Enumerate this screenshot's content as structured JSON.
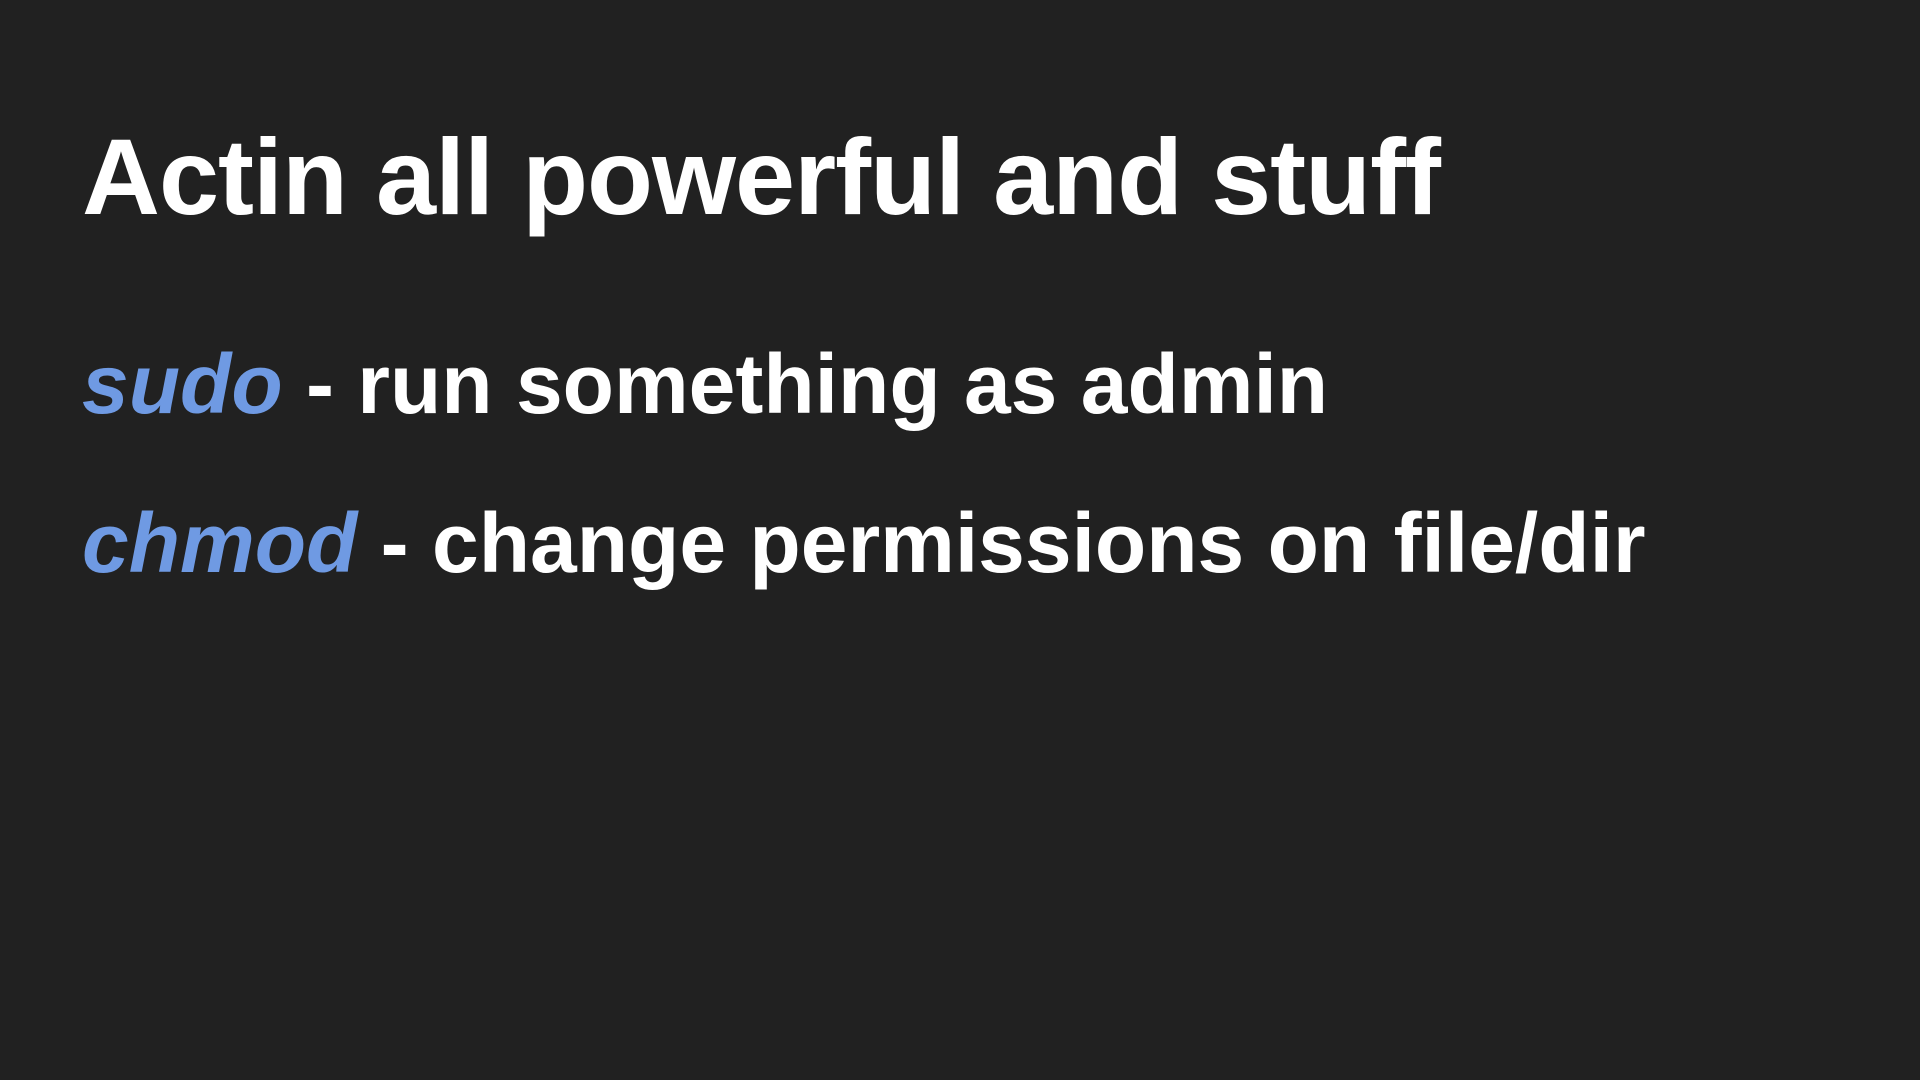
{
  "slide": {
    "title": "Actin all powerful and stuff",
    "items": [
      {
        "command": "sudo",
        "description": " - run something as admin"
      },
      {
        "command": "chmod",
        "description": " - change permissions on file/dir"
      }
    ]
  },
  "colors": {
    "background": "#212121",
    "text": "#ffffff",
    "command_accent": "#6f9ae3"
  }
}
